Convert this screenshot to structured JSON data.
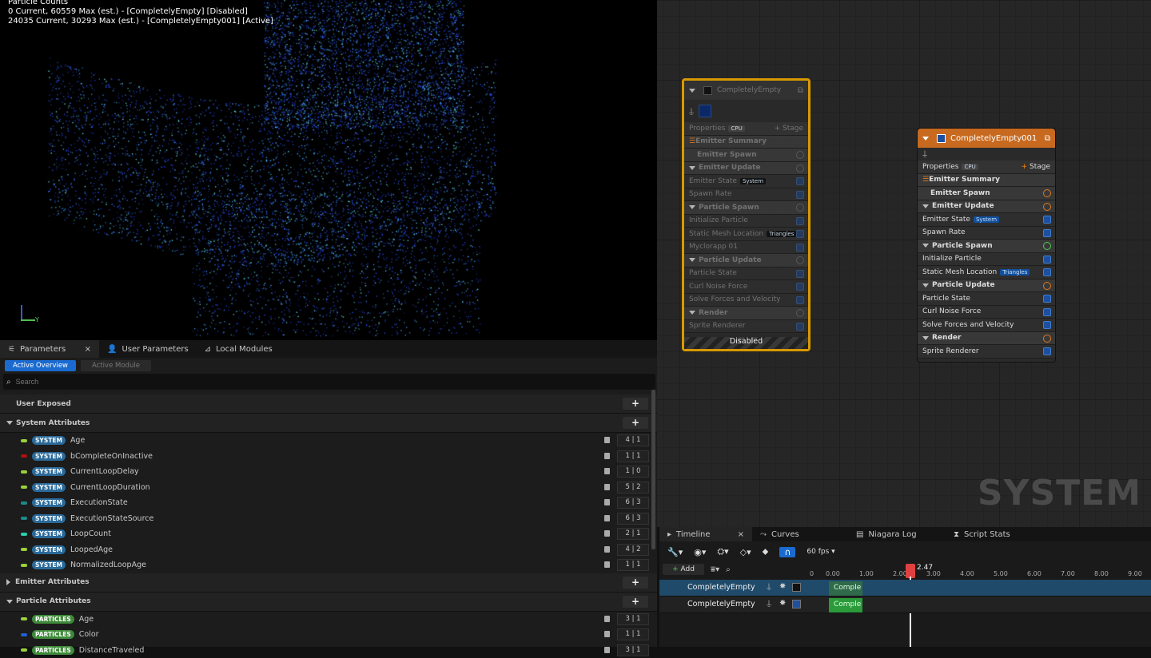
{
  "viewport": {
    "title": "Particle Counts",
    "line1": "0 Current, 60559 Max (est.) - [CompletelyEmpty] [Disabled]",
    "line2": "24035 Current, 30293 Max (est.) - [CompletelyEmpty001] [Active]",
    "axis_z": "Z",
    "axis_y": "Y"
  },
  "node1": {
    "title": "CompletelyEmpty",
    "footer": "Disabled",
    "properties": "Properties",
    "cpu": "CPU",
    "stage": "Stage",
    "rows": [
      {
        "label": "Emitter Summary",
        "sec": true
      },
      {
        "label": "Emitter Spawn",
        "sec": true
      },
      {
        "label": "Emitter Update",
        "sec": true
      },
      {
        "label": "Emitter State",
        "tag": "System"
      },
      {
        "label": "Spawn Rate"
      },
      {
        "label": "Particle Spawn",
        "sec": true
      },
      {
        "label": "Initialize Particle"
      },
      {
        "label": "Static Mesh Location",
        "tag": "Triangles"
      },
      {
        "label": "Myclorapp 01"
      },
      {
        "label": "Particle Update",
        "sec": true
      },
      {
        "label": "Particle State"
      },
      {
        "label": "Curl Noise Force"
      },
      {
        "label": "Solve Forces and Velocity"
      },
      {
        "label": "Render",
        "sec": true
      },
      {
        "label": "Sprite Renderer"
      }
    ]
  },
  "node2": {
    "title": "CompletelyEmpty001",
    "properties": "Properties",
    "cpu": "CPU",
    "stage": "Stage",
    "rows": [
      {
        "label": "Emitter Summary",
        "sec": true
      },
      {
        "label": "Emitter Spawn",
        "sec": true
      },
      {
        "label": "Emitter Update",
        "sec": true
      },
      {
        "label": "Emitter State",
        "tag": "System"
      },
      {
        "label": "Spawn Rate"
      },
      {
        "label": "Particle Spawn",
        "sec": true
      },
      {
        "label": "Initialize Particle"
      },
      {
        "label": "Static Mesh Location",
        "tag": "Triangles"
      },
      {
        "label": "Particle Update",
        "sec": true
      },
      {
        "label": "Particle State"
      },
      {
        "label": "Curl Noise Force"
      },
      {
        "label": "Solve Forces and Velocity"
      },
      {
        "label": "Render",
        "sec": true
      },
      {
        "label": "Sprite Renderer"
      }
    ]
  },
  "graph": {
    "system_label": "SYSTEM"
  },
  "params": {
    "tabs": [
      "Parameters",
      "User Parameters",
      "Local Modules"
    ],
    "active_overview": "Active Overview",
    "active_module": "Active Module",
    "search_placeholder": "Search",
    "user_exposed": "User Exposed",
    "system_attributes": "System Attributes",
    "emitter_attributes": "Emitter Attributes",
    "particle_attributes": "Particle Attributes",
    "system_rows": [
      {
        "name": "Age",
        "val": "4 | 1",
        "color": "#9bd13a"
      },
      {
        "name": "bCompleteOnInactive",
        "val": "1 | 1",
        "color": "#b01010"
      },
      {
        "name": "CurrentLoopDelay",
        "val": "1 | 0",
        "color": "#9bd13a"
      },
      {
        "name": "CurrentLoopDuration",
        "val": "5 | 2",
        "color": "#9bd13a"
      },
      {
        "name": "ExecutionState",
        "val": "6 | 3",
        "color": "#1e8a8a"
      },
      {
        "name": "ExecutionStateSource",
        "val": "6 | 3",
        "color": "#1e8a8a"
      },
      {
        "name": "LoopCount",
        "val": "2 | 1",
        "color": "#2ad0b0"
      },
      {
        "name": "LoopedAge",
        "val": "4 | 2",
        "color": "#9bd13a"
      },
      {
        "name": "NormalizedLoopAge",
        "val": "1 | 1",
        "color": "#9bd13a"
      }
    ],
    "system_pill": "SYSTEM",
    "particle_rows": [
      {
        "name": "Age",
        "val": "3 | 1",
        "color": "#9bd13a"
      },
      {
        "name": "Color",
        "val": "1 | 1",
        "color": "#2060d0"
      },
      {
        "name": "DistanceTraveled",
        "val": "3 | 1",
        "color": "#9bd13a"
      }
    ],
    "particle_pill": "PARTICLES"
  },
  "timeline": {
    "tabs": [
      "Timeline",
      "Curves",
      "Niagara Log",
      "Script Stats"
    ],
    "fps": "60 fps",
    "add": "Add",
    "playhead": "2.47",
    "ticks": [
      "0",
      "0.00",
      "1.00",
      "2.00",
      "3.00",
      "4.00",
      "5.00",
      "6.00",
      "7.00",
      "8.00",
      "9.00"
    ],
    "tracks": [
      {
        "name": "CompletelyEmpty",
        "clip": "Comple"
      },
      {
        "name": "CompletelyEmpty",
        "clip": "Comple"
      }
    ]
  }
}
